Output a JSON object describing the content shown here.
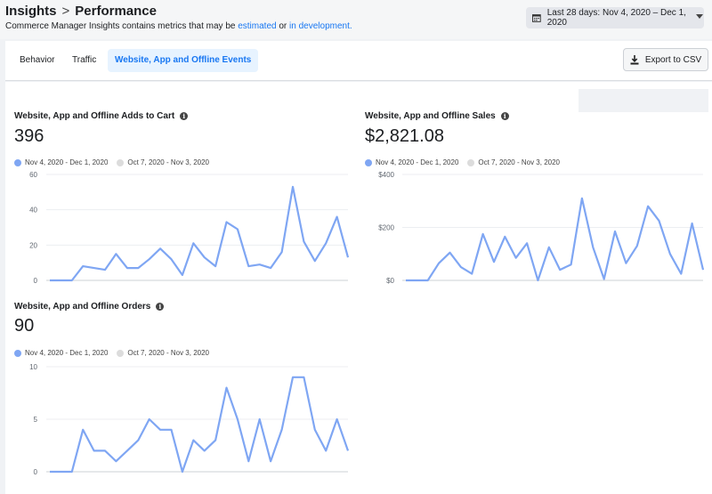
{
  "header": {
    "breadcrumb_parent": "Insights",
    "breadcrumb_current": "Performance",
    "subtitle_prefix": "Commerce Manager Insights contains metrics that may be",
    "subtitle_link1": "estimated",
    "subtitle_or": "or",
    "subtitle_link2": "in development.",
    "date_range": "Last 28 days: Nov 4, 2020 – Dec 1, 2020"
  },
  "tabs": [
    {
      "label": "Behavior"
    },
    {
      "label": "Traffic"
    },
    {
      "label": "Website, App and Offline Events"
    }
  ],
  "export_label": "Export to CSV",
  "colors": {
    "current": "#7fa6f3",
    "previous": "#dcdcdc",
    "accent": "#1877f2"
  },
  "legend": {
    "current": "Nov 4, 2020 - Dec 1, 2020",
    "previous": "Oct 7, 2020 - Nov 3, 2020"
  },
  "metrics": [
    {
      "title": "Website, App and Offline Adds to Cart",
      "value": "396"
    },
    {
      "title": "Website, App and Offline Sales",
      "value": "$2,821.08"
    },
    {
      "title": "Website, App and Offline Orders",
      "value": "90"
    }
  ],
  "chart_data": [
    {
      "type": "line",
      "title": "Website, App and Offline Adds to Cart",
      "ylim": [
        0,
        60
      ],
      "yticks": [
        "0",
        "20",
        "40",
        "60"
      ],
      "series": [
        {
          "name": "Nov 4, 2020 - Dec 1, 2020",
          "values": [
            0,
            0,
            0,
            8,
            7,
            6,
            15,
            7,
            7,
            12,
            18,
            12,
            3,
            21,
            13,
            8,
            33,
            29,
            8,
            9,
            7,
            16,
            53,
            22,
            11,
            21,
            36,
            13
          ]
        }
      ]
    },
    {
      "type": "line",
      "title": "Website, App and Offline Sales",
      "ylim": [
        0,
        400
      ],
      "yticks": [
        "$0",
        "$200",
        "$400"
      ],
      "series": [
        {
          "name": "Nov 4, 2020 - Dec 1, 2020",
          "values": [
            0,
            0,
            0,
            65,
            105,
            50,
            25,
            175,
            70,
            165,
            85,
            140,
            0,
            125,
            40,
            60,
            310,
            125,
            5,
            185,
            65,
            130,
            280,
            225,
            100,
            25,
            215,
            40
          ]
        }
      ]
    },
    {
      "type": "line",
      "title": "Website, App and Offline Orders",
      "ylim": [
        0,
        10
      ],
      "yticks": [
        "0",
        "5",
        "10"
      ],
      "series": [
        {
          "name": "Nov 4, 2020 - Dec 1, 2020",
          "values": [
            0,
            0,
            0,
            4,
            2,
            2,
            1,
            2,
            3,
            5,
            4,
            4,
            0,
            3,
            2,
            3,
            8,
            5,
            1,
            5,
            1,
            4,
            9,
            9,
            4,
            2,
            5,
            2
          ]
        }
      ]
    }
  ]
}
